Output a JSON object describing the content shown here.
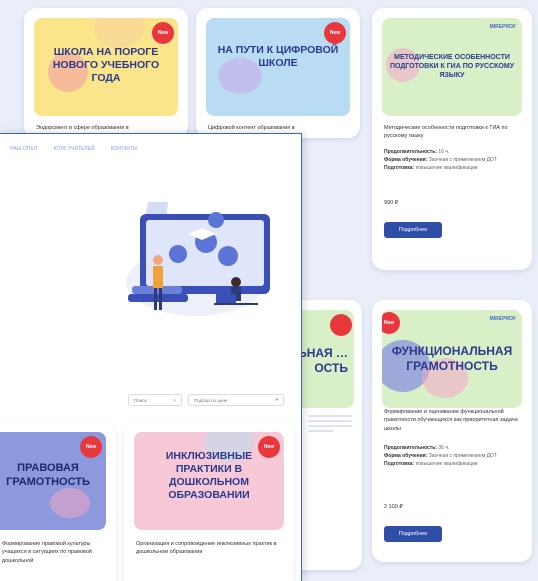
{
  "back_cards": {
    "c1": {
      "title": "Школа на пороге нового учебного года",
      "desc": "Эндорсмент в сфере образования в",
      "badge": "New"
    },
    "c2": {
      "title": "На пути к цифровой школе",
      "desc": "Цифровой контент образования в",
      "badge": "New"
    },
    "c3": {
      "title": "Методические особенности подготовки к ГИА по русскому языку",
      "desc": "Методические особенности подготовки к ГИА по русскому языку",
      "meta1_k": "Продолжительность:",
      "meta1_v": "16 ч.",
      "meta2_k": "Форма обучения:",
      "meta2_v": "Заочная с применением ДОТ",
      "meta3_k": "Подготовка:",
      "meta3_v": "повышение квалификации",
      "price": "990 ₽",
      "button": "Подробнее",
      "logo": "MIREPROF"
    },
    "c4": {
      "title": "…льная …ость"
    },
    "c5": {
      "title": "Функциональная грамотность",
      "desc": "Формирование и оценивание функциональной грамотности обучающихся как приоритетная задача школы",
      "meta1_k": "Продолжительность:",
      "meta1_v": "36 ч.",
      "meta2_k": "Форма обучения:",
      "meta2_v": "Заочная с применением ДОТ",
      "meta3_k": "Подготовка:",
      "meta3_v": "повышение квалификации",
      "price": "2 100 ₽",
      "button": "Подробнее",
      "logo": "MIREPROF",
      "badge": "New"
    }
  },
  "front": {
    "nav": [
      "НАШ ОПЫТ",
      "КЛУБ УЧИТЕЛЕЙ",
      "КОНТАКТЫ"
    ],
    "filter_search": "Поиск",
    "filter_sort": "Подбор по цене",
    "card1": {
      "title": "Правовая грамотность",
      "desc": "Формирование правовой культуры учащихся в ситуациях по правовой дошкольной",
      "badge": "New"
    },
    "card2": {
      "title": "Инклюзивные практики в дошкольном образовании",
      "desc": "Организация и сопровождение инклюзивных практик в дошкольном образовании",
      "badge": "New"
    }
  },
  "colors": {
    "yellow": "#fbe58a",
    "blue": "#b9dcf3",
    "green": "#d9efc8",
    "purple": "#8d99dd",
    "pink": "#f7c9d6",
    "accent": "#2f4fa6",
    "badge": "#e8373d"
  }
}
